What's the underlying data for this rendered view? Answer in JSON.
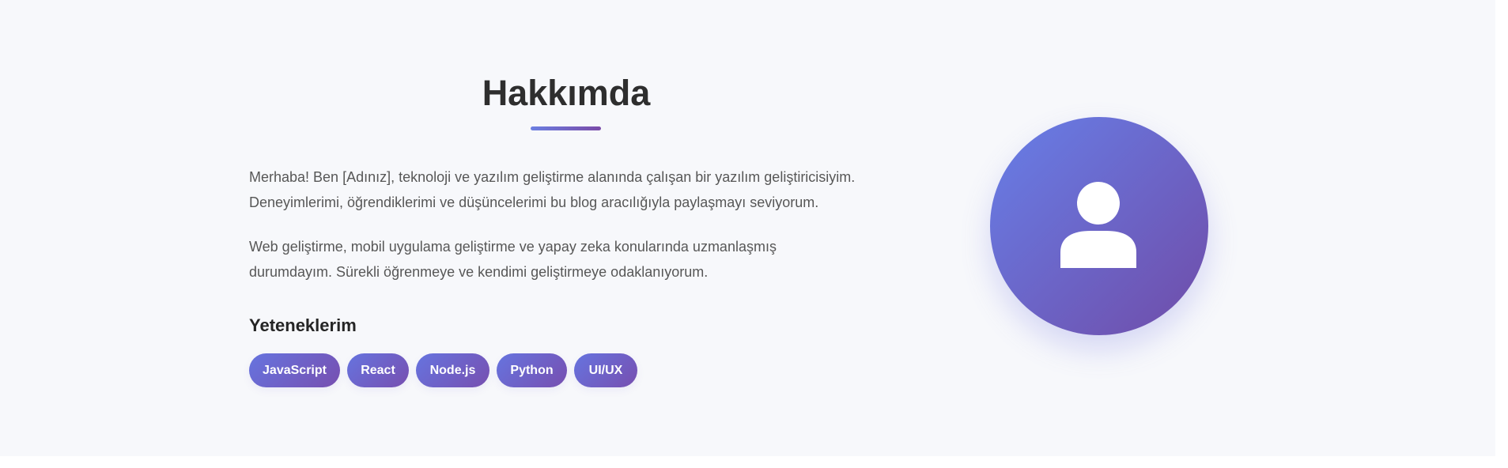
{
  "about": {
    "title": "Hakkımda",
    "paragraphs": [
      {
        "lines": [
          "Merhaba! Ben [Adınız], teknoloji ve yazılım geliştirme alanında çalışan bir yazılım geliştiricisiyim.",
          "Deneyimlerimi, öğrendiklerimi ve düşüncelerimi bu blog aracılığıyla paylaşmayı seviyorum."
        ]
      },
      {
        "lines": [
          "Web geliştirme, mobil uygulama geliştirme ve yapay zeka konularında uzmanlaşmış",
          "durumdayım. Sürekli öğrenmeye ve kendimi geliştirmeye odaklanıyorum."
        ]
      }
    ],
    "skills_heading": "Yeteneklerim",
    "skills": [
      "JavaScript",
      "React",
      "Node.js",
      "Python",
      "UI/UX"
    ],
    "avatar_icon": "user-icon"
  },
  "colors": {
    "page_background": "#f7f8fb",
    "heading_text": "#2e2e2e",
    "body_text": "#575757",
    "accent_start": "#6b7fe1",
    "accent_end": "#7a4ba8",
    "skill_tag_text": "#ffffff"
  }
}
